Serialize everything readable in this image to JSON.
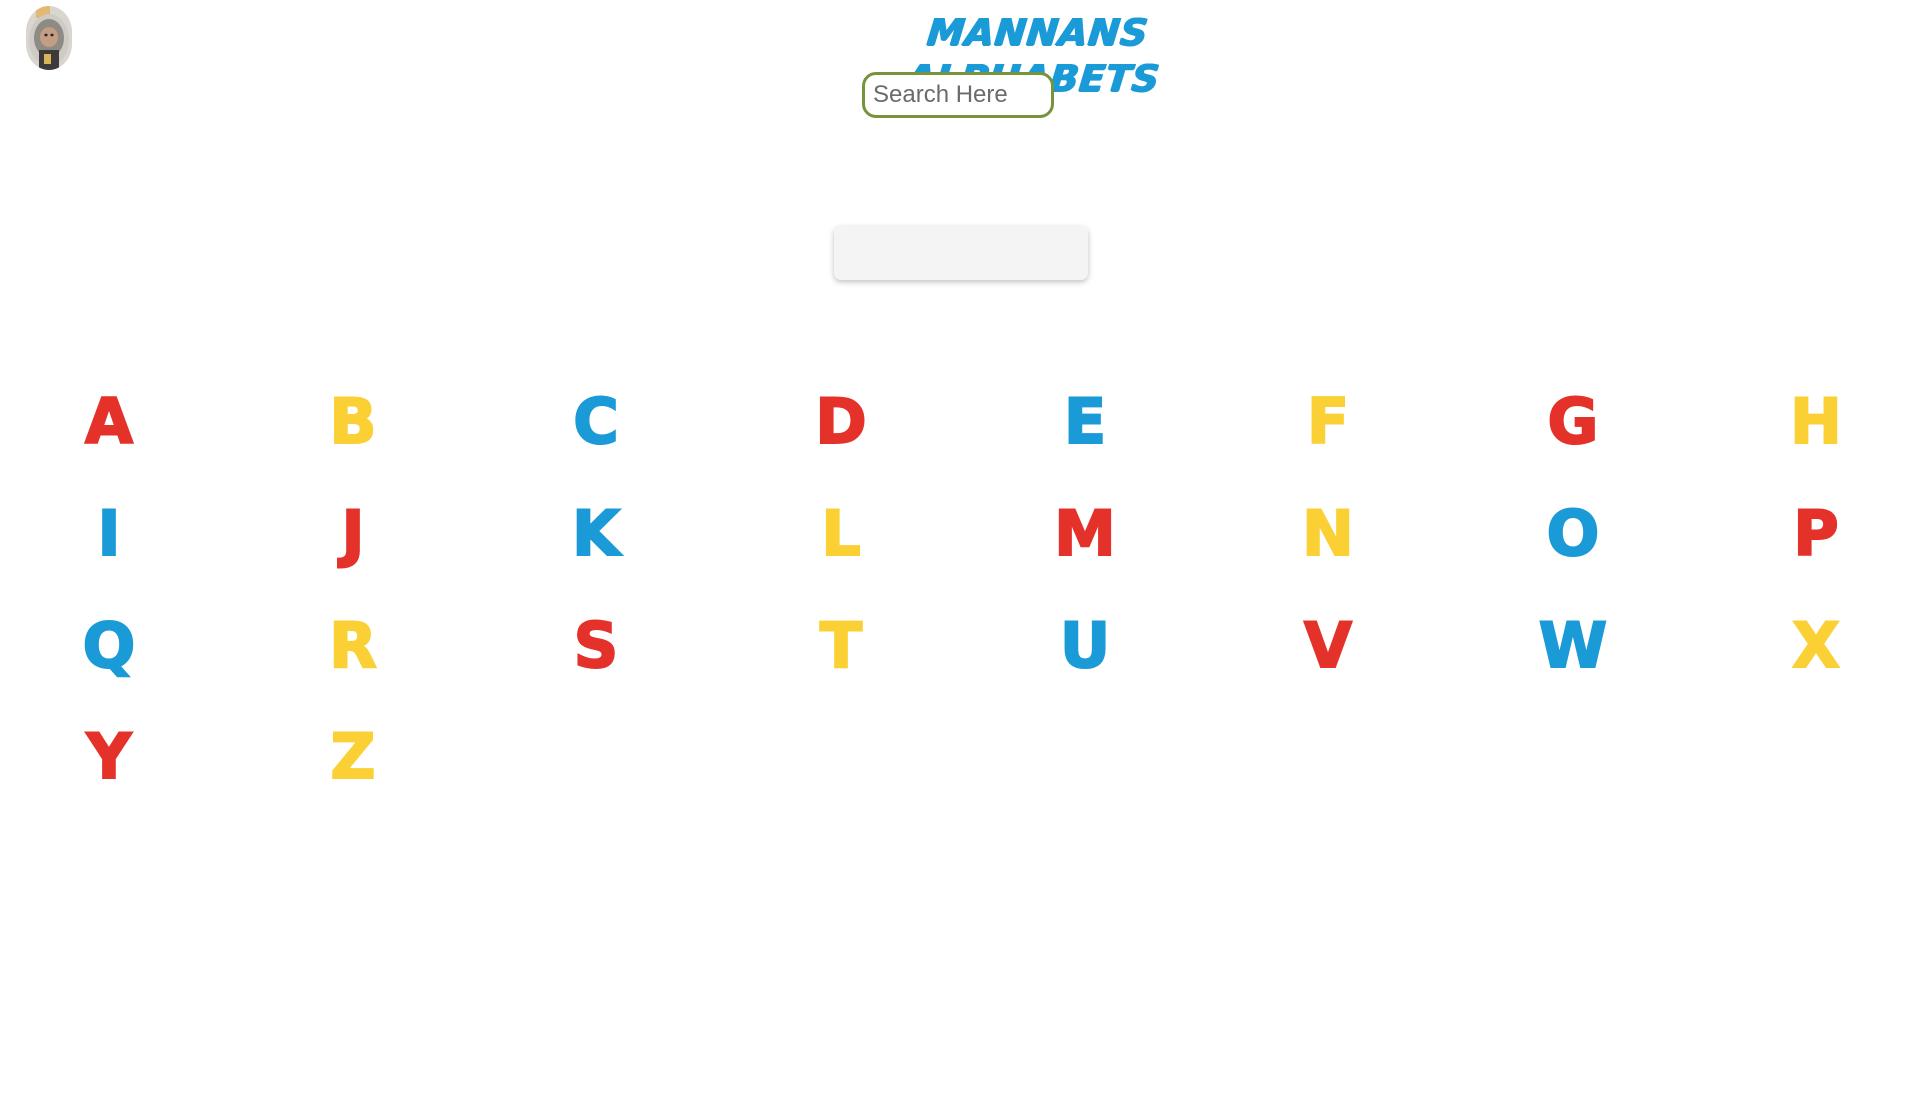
{
  "header": {
    "title": "MANNANS ALPHABETS",
    "avatar_icon": "child-photo-avatar"
  },
  "search": {
    "placeholder": "Search Here",
    "value": "",
    "border_color": "#77943d"
  },
  "colors": {
    "title": "#1a9bd7",
    "red": "#e4322b",
    "yellow": "#fbd035",
    "blue": "#1a9bd7"
  },
  "letters": [
    {
      "char": "A",
      "color": "#e4322b"
    },
    {
      "char": "B",
      "color": "#fbd035"
    },
    {
      "char": "C",
      "color": "#1a9bd7"
    },
    {
      "char": "D",
      "color": "#e4322b"
    },
    {
      "char": "E",
      "color": "#1a9bd7"
    },
    {
      "char": "F",
      "color": "#fbd035"
    },
    {
      "char": "G",
      "color": "#e4322b"
    },
    {
      "char": "H",
      "color": "#fbd035"
    },
    {
      "char": "I",
      "color": "#1a9bd7"
    },
    {
      "char": "J",
      "color": "#e4322b"
    },
    {
      "char": "K",
      "color": "#1a9bd7"
    },
    {
      "char": "L",
      "color": "#fbd035"
    },
    {
      "char": "M",
      "color": "#e4322b"
    },
    {
      "char": "N",
      "color": "#fbd035"
    },
    {
      "char": "O",
      "color": "#1a9bd7"
    },
    {
      "char": "P",
      "color": "#e4322b"
    },
    {
      "char": "Q",
      "color": "#1a9bd7"
    },
    {
      "char": "R",
      "color": "#fbd035"
    },
    {
      "char": "S",
      "color": "#e4322b"
    },
    {
      "char": "T",
      "color": "#fbd035"
    },
    {
      "char": "U",
      "color": "#1a9bd7"
    },
    {
      "char": "V",
      "color": "#e4322b"
    },
    {
      "char": "W",
      "color": "#1a9bd7"
    },
    {
      "char": "X",
      "color": "#fbd035"
    },
    {
      "char": "Y",
      "color": "#e4322b"
    },
    {
      "char": "Z",
      "color": "#fbd035"
    }
  ]
}
